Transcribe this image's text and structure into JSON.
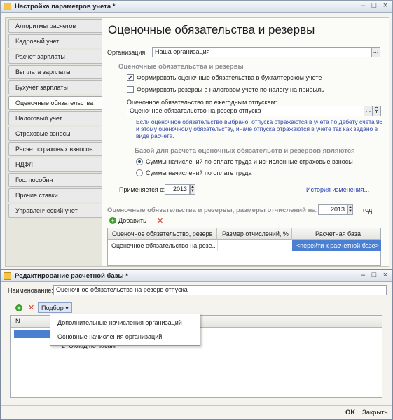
{
  "main_window": {
    "title": "Настройка параметров учета *",
    "controls": {
      "minimize": "–",
      "maximize": "□",
      "close": "×"
    }
  },
  "nav": {
    "items": [
      {
        "label": "Алгоритмы расчетов"
      },
      {
        "label": "Кадровый учет"
      },
      {
        "label": "Расчет зарплаты"
      },
      {
        "label": "Выплата зарплаты"
      },
      {
        "label": "Бухучет зарплаты"
      },
      {
        "label": "Оценочные обязательства"
      },
      {
        "label": "Налоговый учет"
      },
      {
        "label": "Страховые взносы"
      },
      {
        "label": "Расчет страховых взносов"
      },
      {
        "label": "НДФЛ"
      },
      {
        "label": "Гос. пособия"
      },
      {
        "label": "Прочие ставки"
      },
      {
        "label": "Управленческий учет"
      }
    ],
    "active_index": 5
  },
  "content": {
    "heading": "Оценочные обязательства и резервы",
    "org_label": "Организация:",
    "org_value": "Наша организация",
    "select_button": "...",
    "section1_title": "Оценочные обязательства и резервы",
    "check1_label": "Формировать оценочные обязательства в бухгалтерском учете",
    "check1_checked": true,
    "check1_mark": "✔",
    "check2_label": "Формировать резервы в налоговом учете по налогу на прибыль",
    "check2_checked": false,
    "vacation_label": "Оценочное обязательство по ежегодным отпускам:",
    "vacation_value": "Оценочное обязательство на резерв отпуска",
    "hint": "Если оценочное обязательство выбрано, отпуска отражаются в учете по дебету счета 96 и этому оценочному обязательству, иначе отпуска отражаются в учете так как задано в виде расчета.",
    "section2_title": "Базой для расчета оценочных обязательств и резервов являются",
    "radio1_label": "Суммы начислений по оплате труда и исчисленные страховые взносы",
    "radio2_label": "Суммы начислений по оплате труда",
    "radio_selected": 1,
    "applies_label": "Применяется с:",
    "applies_year": "2013",
    "history_link": "История изменения...",
    "table_title": "Оценочные обязательства и резервы, размеры отчислений на:",
    "table_year": "2013",
    "table_year_suffix": "год",
    "add_label": "Добавить",
    "table": {
      "columns": [
        "Оценочное обязательство, резерв",
        "Размер отчислений, %",
        "Расчетная база"
      ],
      "rows": [
        {
          "name": "Оценочное обязательство на резе...",
          "percent": "",
          "base": "<перейти к расчетной базе>"
        }
      ]
    }
  },
  "dialog": {
    "title": "Редактирование расчетной базы *",
    "controls": {
      "minimize": "–",
      "maximize": "□",
      "close": "×"
    },
    "name_label": "Наименование:",
    "name_value": "Оценочное обязательство на резерв отпуска",
    "pick_button": "Подбор",
    "columns": [
      "N"
    ],
    "rows": [
      {
        "n": "2",
        "label": "Оклад по часам"
      }
    ],
    "popup_items": [
      "Дополнительные начисления организаций",
      "Основные начисления организаций"
    ],
    "ok_button": "OK",
    "close_button": "Закрыть"
  },
  "colors": {
    "accent_link": "#2b42b3",
    "section_header": "#8b8c93",
    "hint_text": "#2f47a6",
    "selected_cell": "#4a7fd2",
    "add_icon": "#3f9f2b",
    "delete_icon": "#d43b2a"
  },
  "icons": [
    "app-icon",
    "add-icon",
    "delete-icon",
    "search-icon",
    "dropdown-arrow-icon",
    "spin-arrows-icon"
  ]
}
